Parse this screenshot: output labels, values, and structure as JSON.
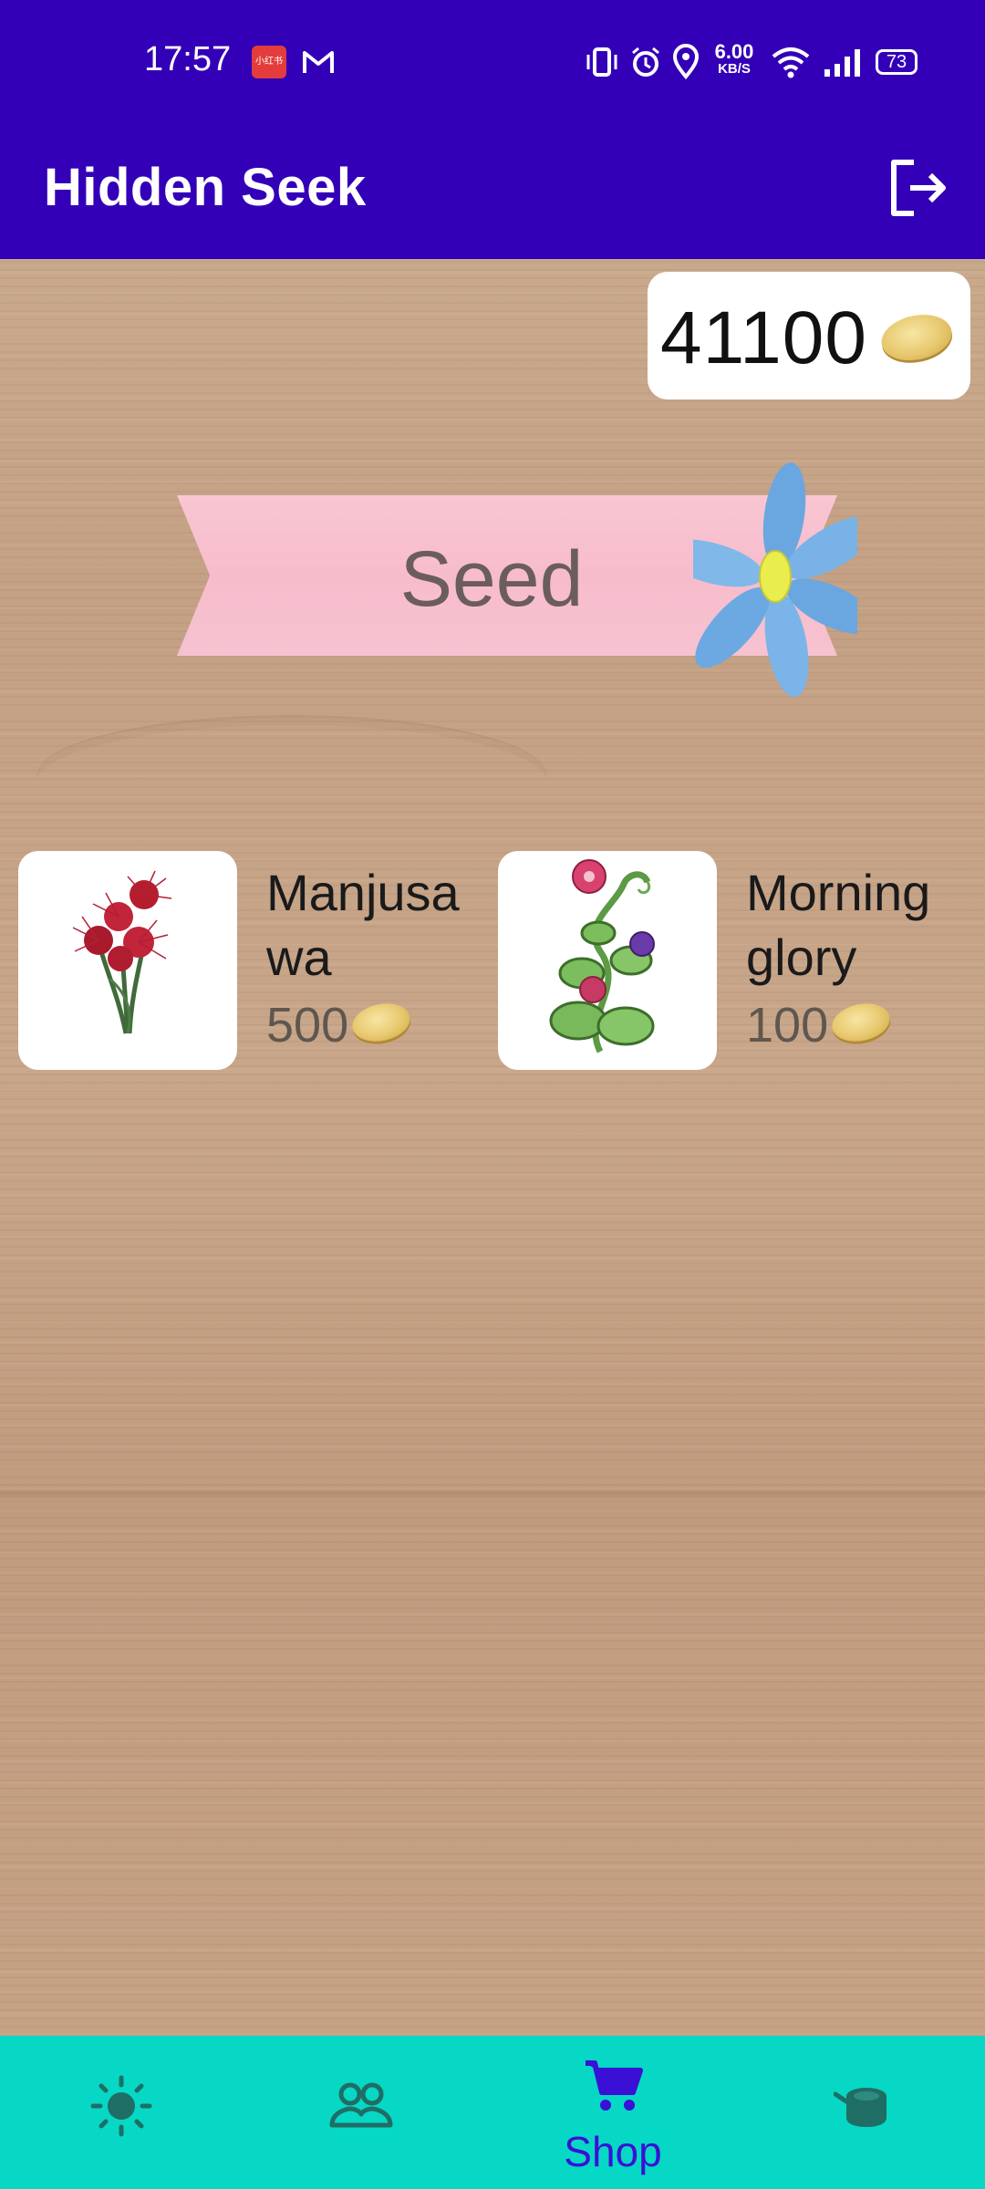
{
  "status_bar": {
    "time": "17:57",
    "app_icon_text": "小红书",
    "net_speed_value": "6.00",
    "net_speed_unit": "KB/S",
    "battery": "73"
  },
  "app_bar": {
    "title": "Hidden Seek",
    "logout_icon": "logout-icon"
  },
  "balance": {
    "value": "41100",
    "icon": "coin-icon"
  },
  "section": {
    "title": "Seed"
  },
  "products": [
    {
      "name": "Manjusawa",
      "name_lines": [
        "Manjusa",
        "wa"
      ],
      "price": "500",
      "icon": "red-spider-lily-icon"
    },
    {
      "name": "Morning glory",
      "name_lines": [
        "Morning",
        "glory"
      ],
      "price": "100",
      "icon": "morning-glory-icon"
    }
  ],
  "bottom_nav": {
    "items": [
      {
        "icon": "sun-icon",
        "label": ""
      },
      {
        "icon": "people-icon",
        "label": ""
      },
      {
        "icon": "cart-icon",
        "label": "Shop",
        "active": true
      },
      {
        "icon": "stump-icon",
        "label": ""
      }
    ],
    "active_color": "#3a10d6",
    "inactive_color": "#1f6e66"
  },
  "colors": {
    "primary": "#3300b8",
    "nav_background": "#06d8c5"
  }
}
